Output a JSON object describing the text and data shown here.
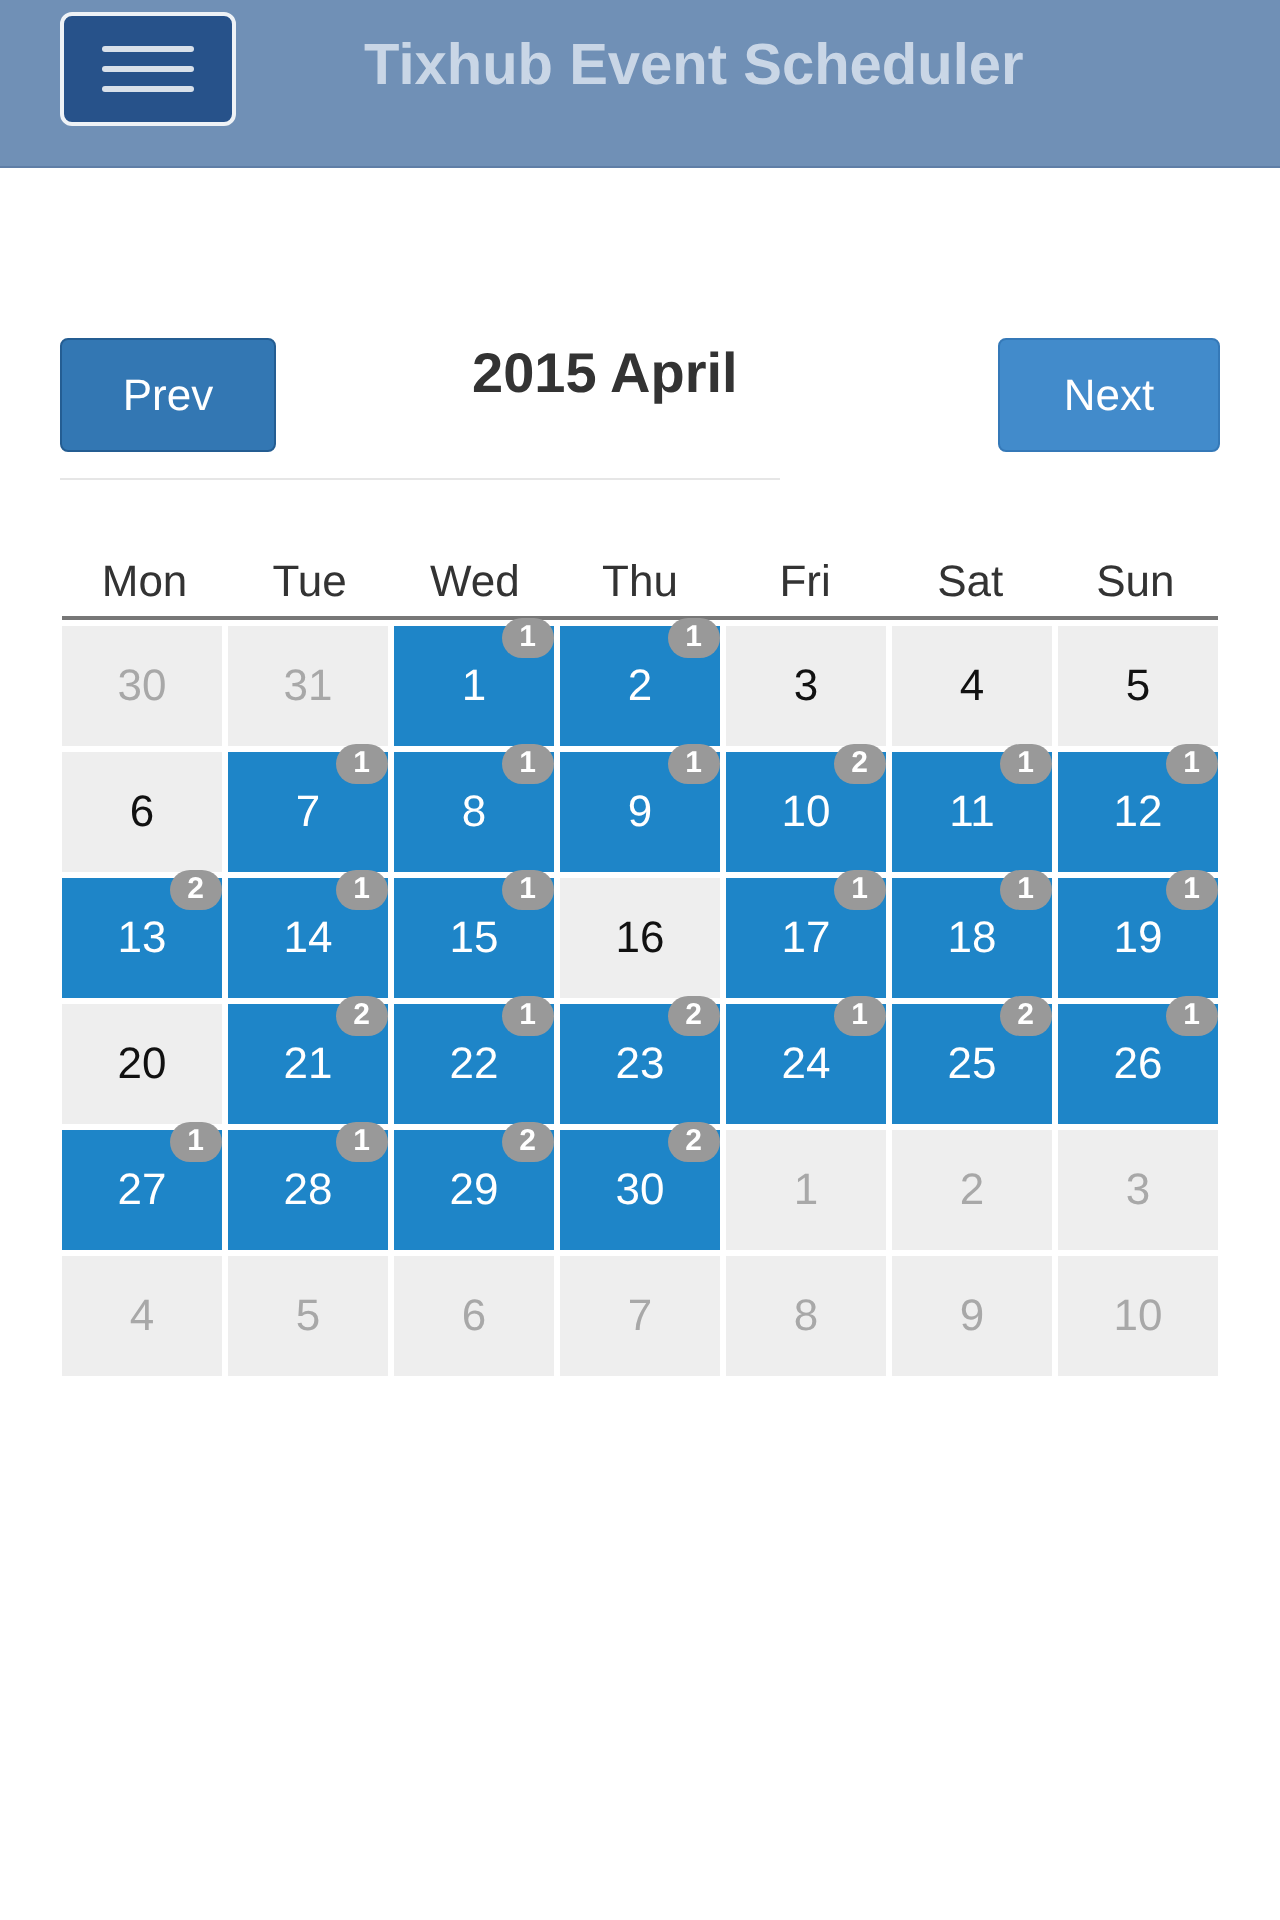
{
  "header": {
    "title": "Tixhub Event Scheduler"
  },
  "nav": {
    "prev": "Prev",
    "title": "2015 April",
    "next": "Next"
  },
  "weekdays": [
    "Mon",
    "Tue",
    "Wed",
    "Thu",
    "Fri",
    "Sat",
    "Sun"
  ],
  "days": [
    {
      "day": "30",
      "kind": "other"
    },
    {
      "day": "31",
      "kind": "other"
    },
    {
      "day": "1",
      "kind": "event",
      "count": "1"
    },
    {
      "day": "2",
      "kind": "event",
      "count": "1"
    },
    {
      "day": "3",
      "kind": "free"
    },
    {
      "day": "4",
      "kind": "free"
    },
    {
      "day": "5",
      "kind": "free"
    },
    {
      "day": "6",
      "kind": "free"
    },
    {
      "day": "7",
      "kind": "event",
      "count": "1"
    },
    {
      "day": "8",
      "kind": "event",
      "count": "1"
    },
    {
      "day": "9",
      "kind": "event",
      "count": "1"
    },
    {
      "day": "10",
      "kind": "event",
      "count": "2"
    },
    {
      "day": "11",
      "kind": "event",
      "count": "1"
    },
    {
      "day": "12",
      "kind": "event",
      "count": "1"
    },
    {
      "day": "13",
      "kind": "event",
      "count": "2"
    },
    {
      "day": "14",
      "kind": "event",
      "count": "1"
    },
    {
      "day": "15",
      "kind": "event",
      "count": "1"
    },
    {
      "day": "16",
      "kind": "free"
    },
    {
      "day": "17",
      "kind": "event",
      "count": "1"
    },
    {
      "day": "18",
      "kind": "event",
      "count": "1"
    },
    {
      "day": "19",
      "kind": "event",
      "count": "1"
    },
    {
      "day": "20",
      "kind": "free"
    },
    {
      "day": "21",
      "kind": "event",
      "count": "2"
    },
    {
      "day": "22",
      "kind": "event",
      "count": "1"
    },
    {
      "day": "23",
      "kind": "event",
      "count": "2"
    },
    {
      "day": "24",
      "kind": "event",
      "count": "1"
    },
    {
      "day": "25",
      "kind": "event",
      "count": "2"
    },
    {
      "day": "26",
      "kind": "event",
      "count": "1"
    },
    {
      "day": "27",
      "kind": "event",
      "count": "1"
    },
    {
      "day": "28",
      "kind": "event",
      "count": "1"
    },
    {
      "day": "29",
      "kind": "event",
      "count": "2"
    },
    {
      "day": "30",
      "kind": "event",
      "count": "2"
    },
    {
      "day": "1",
      "kind": "other"
    },
    {
      "day": "2",
      "kind": "other"
    },
    {
      "day": "3",
      "kind": "other"
    },
    {
      "day": "4",
      "kind": "other"
    },
    {
      "day": "5",
      "kind": "other"
    },
    {
      "day": "6",
      "kind": "other"
    },
    {
      "day": "7",
      "kind": "other"
    },
    {
      "day": "8",
      "kind": "other"
    },
    {
      "day": "9",
      "kind": "other"
    },
    {
      "day": "10",
      "kind": "other"
    }
  ]
}
